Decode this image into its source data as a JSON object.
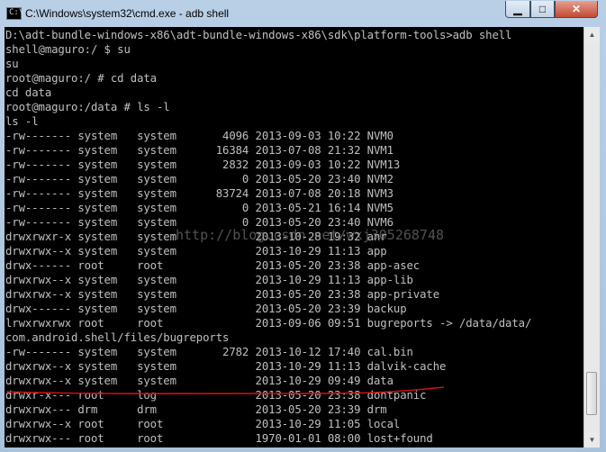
{
  "window": {
    "title": "C:\\Windows\\system32\\cmd.exe - adb  shell",
    "icon_text": "C:\\"
  },
  "controls": {
    "minimize": "▁",
    "maximize": "□",
    "close": "✕"
  },
  "console": {
    "lines": [
      "D:\\adt-bundle-windows-x86\\adt-bundle-windows-x86\\sdk\\platform-tools>adb shell",
      "shell@maguro:/ $ su",
      "su",
      "root@maguro:/ # cd data",
      "cd data",
      "root@maguro:/data # ls -l",
      "ls -l",
      "-rw------- system   system       4096 2013-09-03 10:22 NVM0",
      "-rw------- system   system      16384 2013-07-08 21:32 NVM1",
      "-rw------- system   system       2832 2013-09-03 10:22 NVM13",
      "-rw------- system   system          0 2013-05-20 23:40 NVM2",
      "-rw------- system   system      83724 2013-07-08 20:18 NVM3",
      "-rw------- system   system          0 2013-05-21 16:14 NVM5",
      "-rw------- system   system          0 2013-05-20 23:40 NVM6",
      "drwxrwxr-x system   system            2013-10-28 19:32 anr",
      "drwxrwx--x system   system            2013-10-29 11:13 app",
      "drwx------ root     root              2013-05-20 23:38 app-asec",
      "drwxrwx--x system   system            2013-10-29 11:13 app-lib",
      "drwxrwx--x system   system            2013-05-20 23:38 app-private",
      "drwx------ system   system            2013-05-20 23:39 backup",
      "lrwxrwxrwx root     root              2013-09-06 09:51 bugreports -> /data/data/",
      "com.android.shell/files/bugreports",
      "-rw------- system   system       2782 2013-10-12 17:40 cal.bin",
      "drwxrwx--x system   system            2013-10-29 11:13 dalvik-cache",
      "drwxrwx--x system   system            2013-10-29 09:49 data",
      "drwxr-x--- root     log               2013-05-20 23:38 dontpanic",
      "drwxrwx--- drm      drm               2013-05-20 23:39 drm",
      "drwxrwx--x root     root              2013-10-29 11:05 local",
      "drwxrwx--- root     root              1970-01-01 08:00 lost+found"
    ],
    "watermark": "http://blog.csdn.net/wxj305268748"
  },
  "annotation": {
    "underline_color": "#cc1111"
  },
  "scrollbar": {
    "up": "▲",
    "down": "▼",
    "position": 0.95
  }
}
